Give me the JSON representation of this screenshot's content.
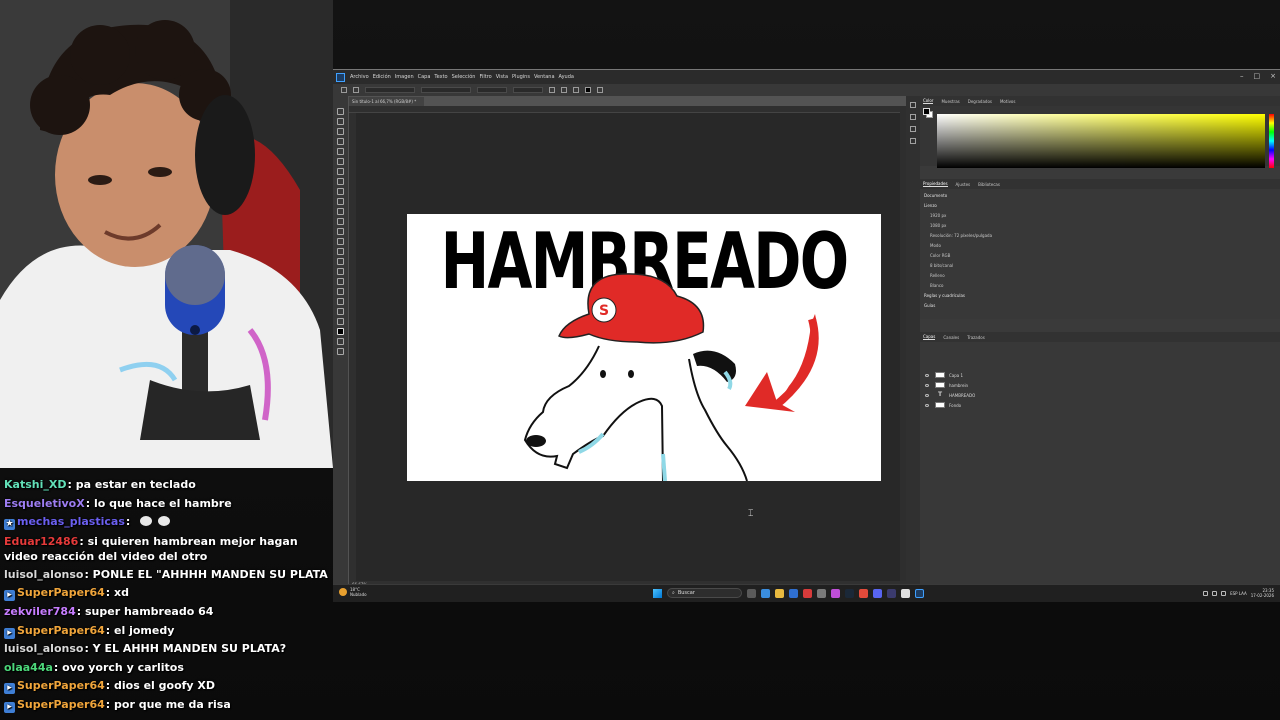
{
  "chat": {
    "messages": [
      {
        "user": "Katshi_XD",
        "color": "#62e0b8",
        "text": "pa estar en teclado",
        "badge": false
      },
      {
        "user": "EsqueletivoX",
        "color": "#9d7df2",
        "text": "lo que hace el hambre",
        "badge": false
      },
      {
        "user": "mechas_plasticas",
        "color": "#6b5ff0",
        "text": "",
        "badge": true,
        "emotes": 2
      },
      {
        "user": "Eduar12486",
        "color": "#e53a3a",
        "text": "si quieren hambrean mejor hagan video reacción del video del otro",
        "badge": false
      },
      {
        "user": "luisol_alonso",
        "color": "#d9d9d9",
        "text": "PONLE EL \"AHHHH MANDEN SU PLATA",
        "badge": false
      },
      {
        "user": "SuperPaper64",
        "color": "#f0a53b",
        "text": "xd",
        "badge": true
      },
      {
        "user": "zekviler784",
        "color": "#c77dff",
        "text": "super hambreado 64",
        "badge": false
      },
      {
        "user": "SuperPaper64",
        "color": "#f0a53b",
        "text": "el jomedy",
        "badge": true
      },
      {
        "user": "luisol_alonso",
        "color": "#d9d9d9",
        "text": "Y EL AHHH MANDEN SU PLATA?",
        "badge": false
      },
      {
        "user": "olaa44a",
        "color": "#4cd77a",
        "text": "ovo yorch y carlitos",
        "badge": false
      },
      {
        "user": "SuperPaper64",
        "color": "#f0a53b",
        "text": "dios el goofy XD",
        "badge": true
      },
      {
        "user": "SuperPaper64",
        "color": "#f0a53b",
        "text": "por que me da risa",
        "badge": true
      }
    ]
  },
  "photoshop": {
    "menu": [
      "Archivo",
      "Edición",
      "Imagen",
      "Capa",
      "Texto",
      "Selección",
      "Filtro",
      "Vista",
      "Plugins",
      "Ventana",
      "Ayuda"
    ],
    "doc_tab": "Sin título-1 al 66,7% (RGB/8#) *",
    "status": "66,67%",
    "artboard_title": "HAMBREADO",
    "cap_letter": "S",
    "color_tabs": [
      "Color",
      "Muestras",
      "Degradados",
      "Motivos"
    ],
    "props_tabs": [
      "Propiedades",
      "Ajustes",
      "Bibliotecas"
    ],
    "props_lines": [
      "Documento",
      "Lienzo",
      "1920 px",
      "1080 px",
      "Resolución: 72 píxeles/pulgada",
      "Modo",
      "Color RGB",
      "8 bits/canal",
      "Relleno",
      "Blanco",
      "Reglas y cuadrículas",
      "Guías"
    ],
    "layers_tabs": [
      "Capas",
      "Canales",
      "Trazados"
    ],
    "layers": [
      {
        "name": "Capa 1",
        "thumb": "img"
      },
      {
        "name": "hambrein",
        "thumb": "img"
      },
      {
        "name": "HAMBREADO",
        "thumb": "text"
      },
      {
        "name": "Fondo",
        "thumb": "white"
      }
    ]
  },
  "taskbar": {
    "weather_temp": "18°C",
    "weather_desc": "Nublado",
    "search_placeholder": "Buscar",
    "time": "23:35",
    "date": "17-02-2026",
    "lang": "ESP LAA"
  },
  "colors": {
    "accent_blue": "#0078d4",
    "mario_red": "#e02a27"
  }
}
